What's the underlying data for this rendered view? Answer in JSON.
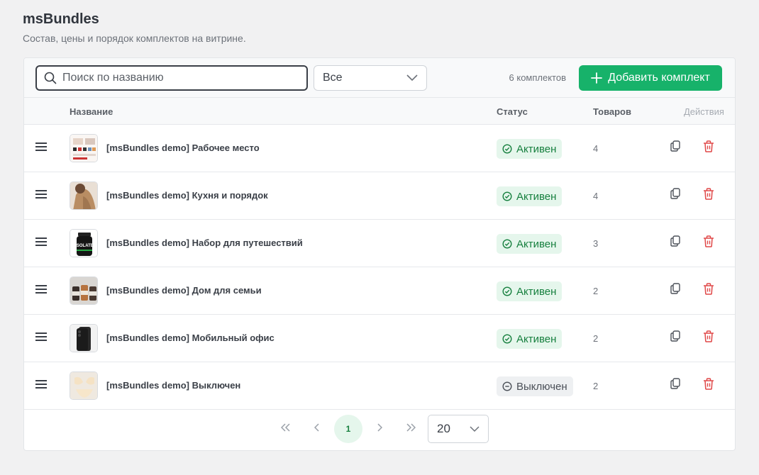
{
  "header": {
    "title": "msBundles",
    "subtitle": "Состав, цены и порядок комплектов на витрине."
  },
  "toolbar": {
    "search_placeholder": "Поиск по названию",
    "status_filter": "Все",
    "count_label": "6 комплектов",
    "add_label": "Добавить комплект"
  },
  "columns": {
    "name": "Название",
    "status": "Статус",
    "items": "Товаров",
    "actions": "Действия"
  },
  "rows": [
    {
      "name": "[msBundles demo] Рабочее место",
      "status": "Активен",
      "status_kind": "active",
      "items": "4",
      "thumb": "desk-collage"
    },
    {
      "name": "[msBundles demo] Кухня и порядок",
      "status": "Активен",
      "status_kind": "active",
      "items": "4",
      "thumb": "sweater-person"
    },
    {
      "name": "[msBundles demo] Набор для путешествий",
      "status": "Активен",
      "status_kind": "active",
      "items": "3",
      "thumb": "isolate-jar"
    },
    {
      "name": "[msBundles demo] Дом для семьи",
      "status": "Активен",
      "status_kind": "active",
      "items": "2",
      "thumb": "bottles"
    },
    {
      "name": "[msBundles demo] Мобильный офис",
      "status": "Активен",
      "status_kind": "active",
      "items": "2",
      "thumb": "phone"
    },
    {
      "name": "[msBundles demo] Выключен",
      "status": "Выключен",
      "status_kind": "off",
      "items": "2",
      "thumb": "lingerie"
    }
  ],
  "pagination": {
    "current_page": "1",
    "per_page": "20"
  },
  "colors": {
    "accent": "#17b26a",
    "active_text": "#17803f",
    "active_bg": "#e5f6ec",
    "delete": "#e04848"
  }
}
